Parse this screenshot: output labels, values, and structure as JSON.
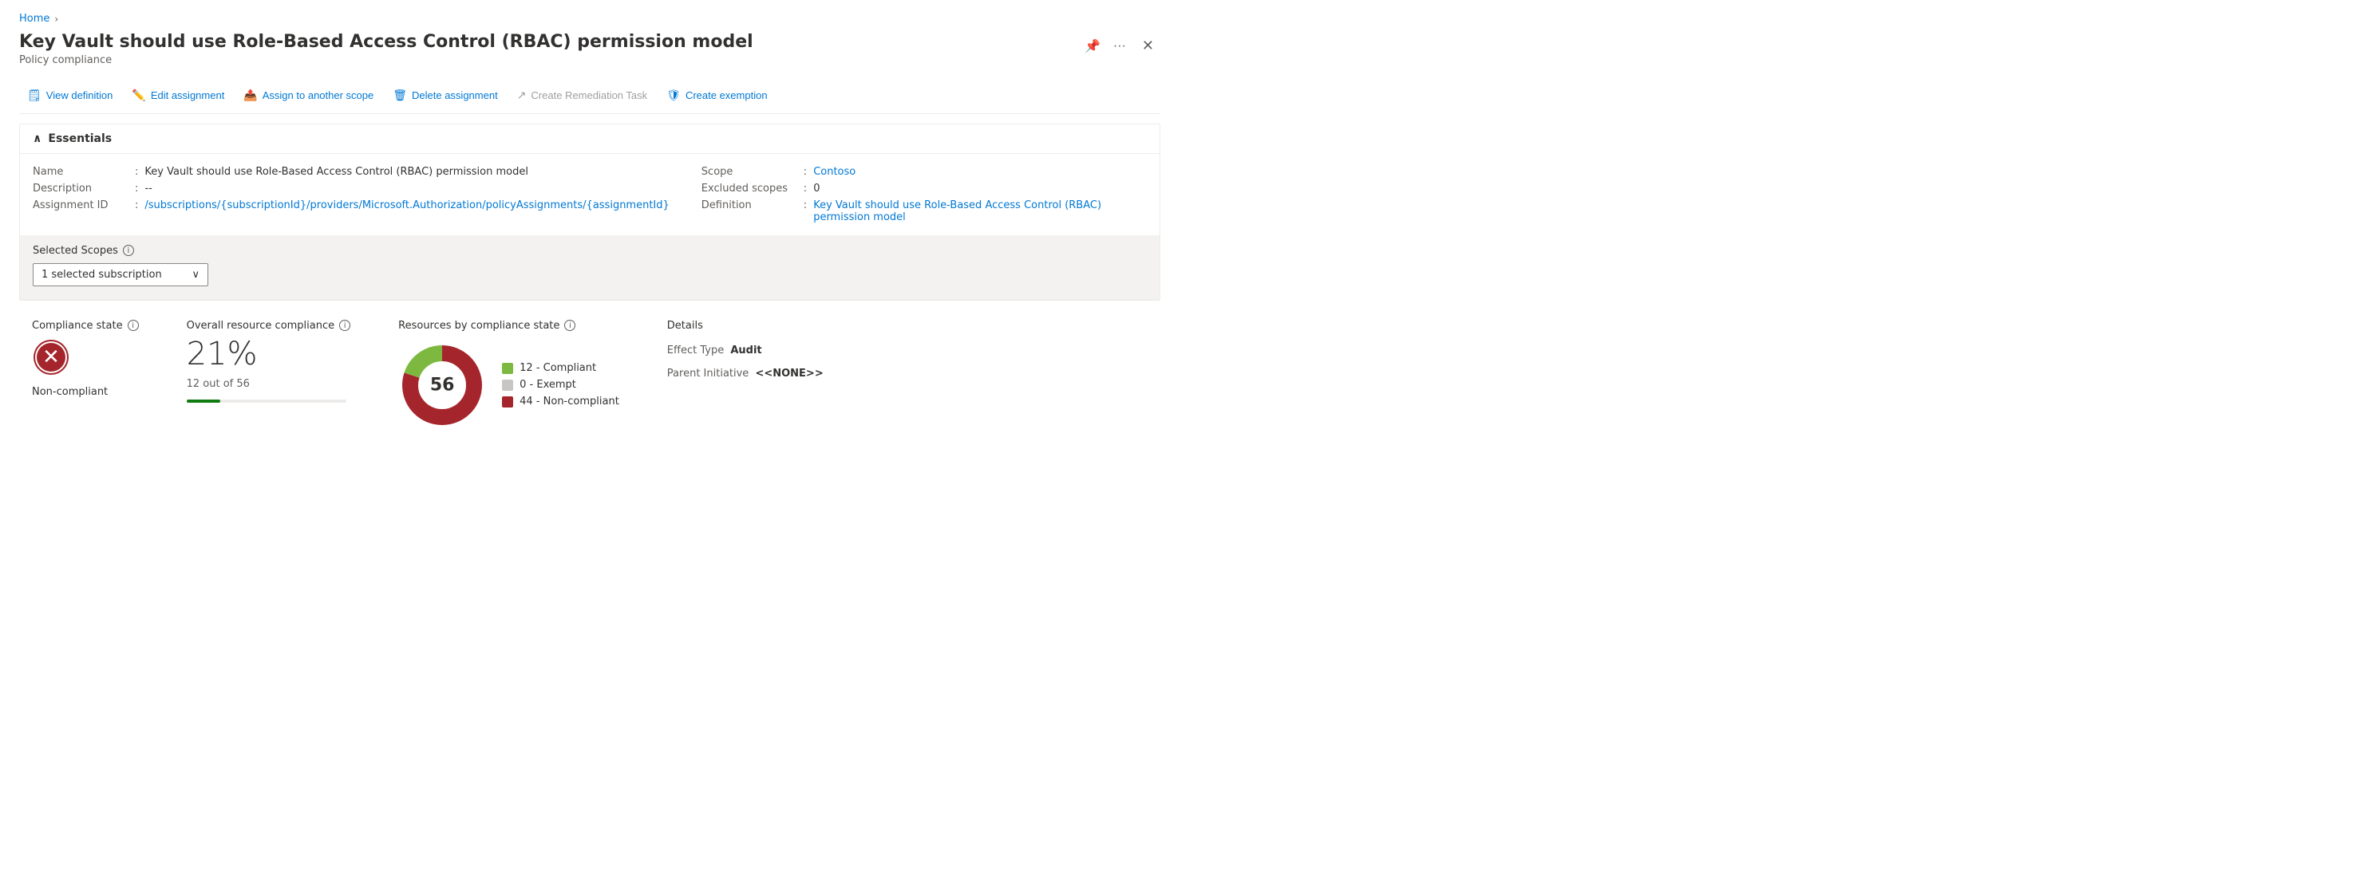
{
  "breadcrumb": {
    "home": "Home"
  },
  "page": {
    "title": "Key Vault should use Role-Based Access Control (RBAC) permission model",
    "subtitle": "Policy compliance"
  },
  "toolbar": {
    "view_definition": "View definition",
    "edit_assignment": "Edit assignment",
    "assign_to_another_scope": "Assign to another scope",
    "delete_assignment": "Delete assignment",
    "create_remediation_task": "Create Remediation Task",
    "create_exemption": "Create exemption"
  },
  "essentials": {
    "header": "Essentials",
    "name_label": "Name",
    "name_value": "Key Vault should use Role-Based Access Control (RBAC) permission model",
    "description_label": "Description",
    "description_value": "--",
    "assignment_id_label": "Assignment ID",
    "assignment_id_value": "/subscriptions/{subscriptionId}/providers/Microsoft.Authorization/policyAssignments/{assignmentId}",
    "scope_label": "Scope",
    "scope_value": "Contoso",
    "excluded_scopes_label": "Excluded scopes",
    "excluded_scopes_value": "0",
    "definition_label": "Definition",
    "definition_value": "Key Vault should use Role-Based Access Control (RBAC) permission model"
  },
  "scopes": {
    "label": "Selected Scopes",
    "dropdown_value": "1 selected subscription"
  },
  "compliance": {
    "state_title": "Compliance state",
    "state_label": "Non-compliant",
    "overall_title": "Overall resource compliance",
    "overall_pct": "21%",
    "overall_sub": "12 out of 56",
    "progress_pct": 21,
    "chart_title": "Resources by compliance state",
    "total": "56",
    "compliant_count": 12,
    "exempt_count": 0,
    "noncompliant_count": 44,
    "compliant_label": "12 - Compliant",
    "exempt_label": "0 - Exempt",
    "noncompliant_label": "44 - Non-compliant",
    "colors": {
      "compliant": "#7db940",
      "exempt": "#c8c6c4",
      "noncompliant": "#a4262c"
    },
    "details_title": "Details",
    "effect_type_key": "Effect Type",
    "effect_type_val": "Audit",
    "parent_initiative_key": "Parent Initiative",
    "parent_initiative_val": "<<NONE>>"
  }
}
